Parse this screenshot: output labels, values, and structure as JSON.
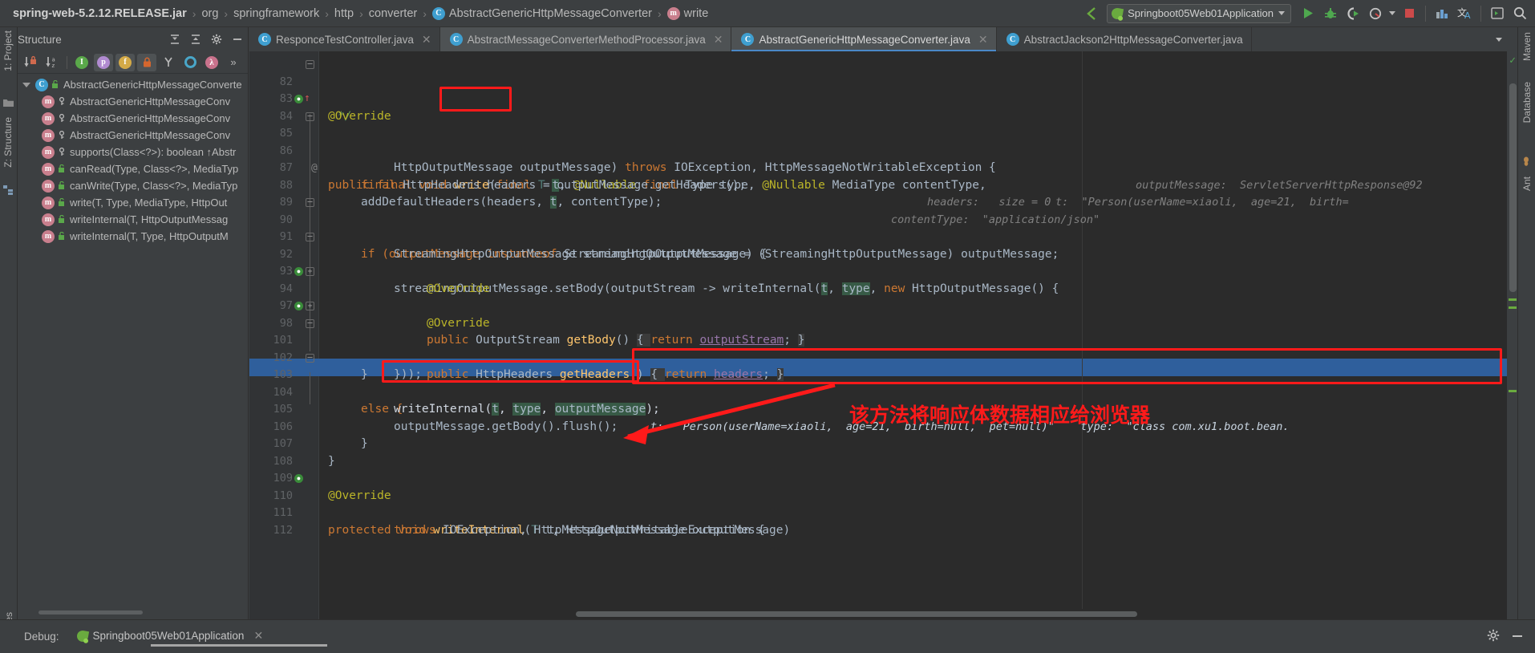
{
  "breadcrumb": {
    "items": [
      {
        "label": "spring-web-5.2.12.RELEASE.jar",
        "icon": "",
        "bold": true
      },
      {
        "label": "org",
        "icon": ""
      },
      {
        "label": "springframework",
        "icon": ""
      },
      {
        "label": "http",
        "icon": ""
      },
      {
        "label": "converter",
        "icon": ""
      },
      {
        "label": "AbstractGenericHttpMessageConverter",
        "icon": "class-icon"
      },
      {
        "label": "write",
        "icon": "method-icon"
      }
    ],
    "separator": "›"
  },
  "toolbar": {
    "run_config": "Springboot05Web01Application",
    "run_button": "Run",
    "debug_button": "Debug",
    "run_coverage_button": "Run with Coverage",
    "profile_button": "Profiler",
    "stop_button": "Stop",
    "build_button": "Build Project",
    "translate_button": "Translate",
    "terminal_button": "Terminal",
    "search_button": "Search Everywhere"
  },
  "tabs": [
    {
      "label": "ResponceTestController.java",
      "icon": "class-icon",
      "active": false,
      "closable": true
    },
    {
      "label": "AbstractMessageConverterMethodProcessor.java",
      "icon": "class-readonly-icon",
      "active": false,
      "closable": true
    },
    {
      "label": "AbstractGenericHttpMessageConverter.java",
      "icon": "class-readonly-icon",
      "active": true,
      "closable": true
    },
    {
      "label": "AbstractJackson2HttpMessageConverter.java",
      "icon": "class-readonly-icon",
      "active": false,
      "closable": false
    }
  ],
  "structure": {
    "title": "Structure",
    "toolbar_buttons": [
      {
        "name": "sort-by-visibility",
        "label": "↓"
      },
      {
        "name": "sort-alphabetically",
        "label": "↓az"
      },
      {
        "name": "show-inherited",
        "label": "I"
      },
      {
        "name": "show-properties",
        "label": "p",
        "pressed": true
      },
      {
        "name": "show-fields",
        "label": "f",
        "pressed": true
      },
      {
        "name": "show-non-public",
        "label": "🔒",
        "pressed": true
      },
      {
        "name": "group-methods",
        "label": "Y"
      },
      {
        "name": "show-anonymous",
        "label": "O"
      },
      {
        "name": "show-lambdas",
        "label": "λ"
      },
      {
        "name": "more-options",
        "label": "»"
      }
    ],
    "tree": [
      {
        "label": "AbstractGenericHttpMessageConverte",
        "icon": "class-icon",
        "depth": 0,
        "expanded": true,
        "access": "public"
      },
      {
        "label": "AbstractGenericHttpMessageConv",
        "icon": "method-icon",
        "depth": 1,
        "access": "protected"
      },
      {
        "label": "AbstractGenericHttpMessageConv",
        "icon": "method-icon",
        "depth": 1,
        "access": "protected"
      },
      {
        "label": "AbstractGenericHttpMessageConv",
        "icon": "method-icon",
        "depth": 1,
        "access": "protected"
      },
      {
        "label": "supports(Class<?>): boolean ↑Abstr",
        "icon": "method-icon",
        "depth": 1,
        "access": "protected"
      },
      {
        "label": "canRead(Type, Class<?>, MediaTyp",
        "icon": "method-icon",
        "depth": 1,
        "access": "public"
      },
      {
        "label": "canWrite(Type, Class<?>, MediaTyp",
        "icon": "method-icon",
        "depth": 1,
        "access": "public"
      },
      {
        "label": "write(T, Type, MediaType, HttpOut",
        "icon": "method-icon",
        "depth": 1,
        "access": "public"
      },
      {
        "label": "writeInternal(T, HttpOutputMessag",
        "icon": "method-icon",
        "depth": 1,
        "access": "public"
      },
      {
        "label": "writeInternal(T, Type, HttpOutputM",
        "icon": "method-icon",
        "depth": 1,
        "access": "public"
      }
    ]
  },
  "left_strip": [
    {
      "label": "1: Project"
    },
    {
      "label": "Z: Structure"
    }
  ],
  "right_strip": [
    {
      "label": "Maven"
    },
    {
      "label": "Database"
    },
    {
      "label": "Ant"
    }
  ],
  "bottom_strip": {
    "label": "Favorites"
  },
  "editor": {
    "lines": [
      {
        "n": "82",
        "fold": "minus"
      },
      {
        "n": "83"
      },
      {
        "n": "84",
        "bp": true,
        "arrow": true,
        "at": true
      },
      {
        "n": "85",
        "fold": "minus"
      },
      {
        "n": "86"
      },
      {
        "n": "87"
      },
      {
        "n": "88"
      },
      {
        "n": "89"
      },
      {
        "n": "90",
        "fold": "minus"
      },
      {
        "n": "91"
      },
      {
        "n": "92",
        "fold": "minus"
      },
      {
        "n": "93"
      },
      {
        "n": "94",
        "bp": true,
        "fold": "minus"
      },
      {
        "n": "97"
      },
      {
        "n": "98",
        "bp": true,
        "fold": "minus"
      },
      {
        "n": "101",
        "fold": "minus"
      },
      {
        "n": "102"
      },
      {
        "n": "103",
        "fold": "minus"
      },
      {
        "n": "104",
        "highlight": true
      },
      {
        "n": "105"
      },
      {
        "n": "106"
      },
      {
        "n": "107"
      },
      {
        "n": "108"
      },
      {
        "n": "109"
      },
      {
        "n": "110",
        "bp": true
      },
      {
        "n": "111"
      },
      {
        "n": "112"
      }
    ],
    "code": {
      "l82": "*/",
      "l83": "@Override",
      "l84_a": "public final void ",
      "l84_b": "write",
      "l84_c": "(",
      "l84_d": "final",
      "l84_e": " T ",
      "l84_f": "t",
      "l84_g": ", ",
      "l84_h": "@Nullable",
      "l84_i": " final ",
      "l84_j": "Type",
      "l84_k": " type, ",
      "l84_l": "@Nullable",
      "l84_m": " MediaType contentType,",
      "l84_hint": "t:  \"Person(userName=xiaoli,  age=21,  birth=",
      "l85": "HttpOutputMessage outputMessage) ",
      "l85_kw": "throws",
      "l85_b": " IOException, HttpMessageNotWritableException {",
      "l85_hint": "outputMessage:  ServletServerHttpResponse@92",
      "l87_kw": "final",
      "l87_b": " HttpHeaders headers = outputMessage.getHeaders();",
      "l87_hint": "headers:   size = 0",
      "l88": "addDefaultHeaders(headers, ",
      "l88_t": "t",
      "l88_b": ", contentType);",
      "l88_hint": "contentType:  \"application/json\"",
      "l90_a": "if (outputMessage ",
      "l90_kw": "instanceof",
      "l90_b": " StreamingHttpOutputMessage) {",
      "l91": "StreamingHttpOutputMessage streamingOutputMessage = (StreamingHttpOutputMessage) outputMessage;",
      "l92_a": "streamingOutputMessage.setBody(outputStream -> writeInternal(",
      "l92_t": "t",
      "l92_b": ", ",
      "l92_type": "type",
      "l92_c": ", ",
      "l92_kw": "new",
      "l92_d": " HttpOutputMessage() {",
      "l93": "@Override",
      "l94_a": "public ",
      "l94_b": "OutputStream",
      "l94_c": " getBody",
      "l94_d": "() ",
      "l94_e": "{ ",
      "l94_kw": "return",
      "l94_f": " ",
      "l94_g": "outputStream",
      "l94_h": "; ",
      "l94_i": "}",
      "l97": "@Override",
      "l98_a": "public ",
      "l98_b": "HttpHeaders",
      "l98_c": " getHeaders",
      "l98_d": "() ",
      "l98_e": "{ ",
      "l98_kw": "return",
      "l98_f": " ",
      "l98_g": "headers",
      "l98_h": "; ",
      "l98_i": "}",
      "l101": "}));",
      "l102": "}",
      "l103": "else {",
      "l104_a": "writeInternal(",
      "l104_t": "t",
      "l104_b": ", ",
      "l104_type": "type",
      "l104_c": ", ",
      "l104_om": "outputMessage",
      "l104_d": ");",
      "l104_hint": "t:  \"Person(userName=xiaoli,  age=21,  birth=null,  pet=null)\"    type:  \"class com.xu1.boot.bean.",
      "l105": "outputMessage.getBody().flush();",
      "l106": "}",
      "l107": "}",
      "l109": "@Override",
      "l110_a": "protected void ",
      "l110_b": "writeInternal",
      "l110_c": "(",
      "l110_d": "T",
      "l110_e": " t, HttpOutputMessage outputMessage)",
      "l111_kw": "throws",
      "l111_b": " IOException, HttpMessageNotWritableException {"
    }
  },
  "annotation": {
    "note_text": "该方法将响应体数据相应给浏览器",
    "color": "#ff1a1a"
  },
  "debug_panel": {
    "label": "Debug:",
    "session_name": "Springboot05Web01Application",
    "close": "×",
    "settings_icon": "gear-icon",
    "minimize_icon": "minimize-icon"
  },
  "colors": {
    "accent": "#4a88c7",
    "annotation_red": "#ff1a1a",
    "editor_bg": "#2b2b2b",
    "panel_bg": "#3c3f41",
    "selection_blue": "#2f5f9c"
  }
}
